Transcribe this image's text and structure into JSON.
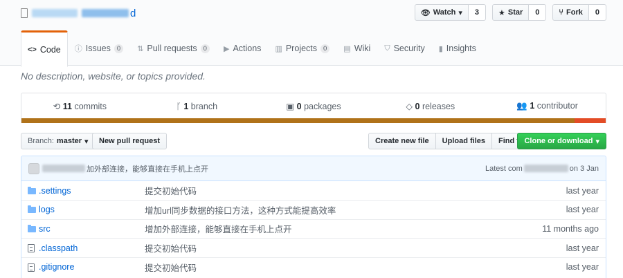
{
  "repo": {
    "name_suffix": "d"
  },
  "actions": {
    "watch": {
      "label": "Watch",
      "count": "3"
    },
    "star": {
      "label": "Star",
      "count": "0"
    },
    "fork": {
      "label": "Fork",
      "count": "0"
    }
  },
  "tabs": [
    {
      "label": "Code"
    },
    {
      "label": "Issues",
      "count": "0"
    },
    {
      "label": "Pull requests",
      "count": "0"
    },
    {
      "label": "Actions"
    },
    {
      "label": "Projects",
      "count": "0"
    },
    {
      "label": "Wiki"
    },
    {
      "label": "Security"
    },
    {
      "label": "Insights"
    }
  ],
  "description": "No description, website, or topics provided.",
  "summary": {
    "commits": {
      "num": "11",
      "label": "commits"
    },
    "branches": {
      "num": "1",
      "label": "branch"
    },
    "packages": {
      "num": "0",
      "label": "packages"
    },
    "releases": {
      "num": "0",
      "label": "releases"
    },
    "contributors": {
      "num": "1",
      "label": "contributor"
    }
  },
  "language_bar": {
    "primary_color": "#b07219",
    "secondary_color": "#e34c26",
    "primary_share": 0.947
  },
  "file_nav": {
    "branch_prefix": "Branch:",
    "branch": "master",
    "new_pr": "New pull request",
    "create_file": "Create new file",
    "upload_files": "Upload files",
    "find_file": "Find file",
    "clone": "Clone or download"
  },
  "commit_tease": {
    "message": "加外部连接，能够直接在手机上点开",
    "latest_prefix": "Latest com",
    "date_suffix": "on 3 Jan"
  },
  "files": [
    {
      "type": "folder",
      "name": ".settings",
      "message": "提交初始代码",
      "age": "last year"
    },
    {
      "type": "folder",
      "name": "logs",
      "message": "增加url同步数据的接口方法，这种方式能提高效率",
      "age": "last year"
    },
    {
      "type": "folder",
      "name": "src",
      "message": "增加外部连接，能够直接在手机上点开",
      "age": "11 months ago"
    },
    {
      "type": "file",
      "name": ".classpath",
      "message": "提交初始代码",
      "age": "last year"
    },
    {
      "type": "file",
      "name": ".gitignore",
      "message": "提交初始代码",
      "age": "last year"
    }
  ],
  "colors": {
    "link": "#0366d6",
    "accent_tab": "#e36209",
    "clone_green": "#28a745"
  }
}
